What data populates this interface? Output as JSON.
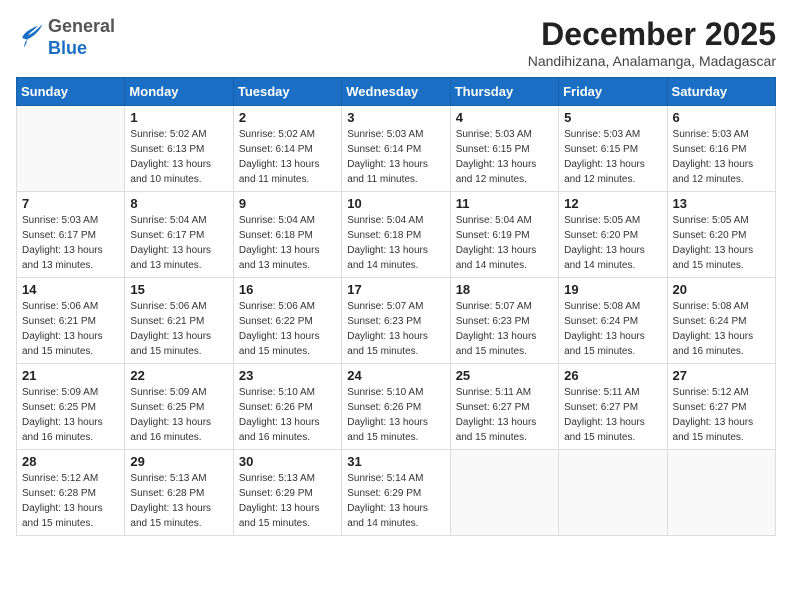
{
  "logo": {
    "general": "General",
    "blue": "Blue"
  },
  "title": "December 2025",
  "location": "Nandihizana, Analamanga, Madagascar",
  "days_of_week": [
    "Sunday",
    "Monday",
    "Tuesday",
    "Wednesday",
    "Thursday",
    "Friday",
    "Saturday"
  ],
  "weeks": [
    [
      {
        "day": "",
        "sunrise": "",
        "sunset": "",
        "daylight": ""
      },
      {
        "day": "1",
        "sunrise": "Sunrise: 5:02 AM",
        "sunset": "Sunset: 6:13 PM",
        "daylight": "Daylight: 13 hours and 10 minutes."
      },
      {
        "day": "2",
        "sunrise": "Sunrise: 5:02 AM",
        "sunset": "Sunset: 6:14 PM",
        "daylight": "Daylight: 13 hours and 11 minutes."
      },
      {
        "day": "3",
        "sunrise": "Sunrise: 5:03 AM",
        "sunset": "Sunset: 6:14 PM",
        "daylight": "Daylight: 13 hours and 11 minutes."
      },
      {
        "day": "4",
        "sunrise": "Sunrise: 5:03 AM",
        "sunset": "Sunset: 6:15 PM",
        "daylight": "Daylight: 13 hours and 12 minutes."
      },
      {
        "day": "5",
        "sunrise": "Sunrise: 5:03 AM",
        "sunset": "Sunset: 6:15 PM",
        "daylight": "Daylight: 13 hours and 12 minutes."
      },
      {
        "day": "6",
        "sunrise": "Sunrise: 5:03 AM",
        "sunset": "Sunset: 6:16 PM",
        "daylight": "Daylight: 13 hours and 12 minutes."
      }
    ],
    [
      {
        "day": "7",
        "sunrise": "Sunrise: 5:03 AM",
        "sunset": "Sunset: 6:17 PM",
        "daylight": "Daylight: 13 hours and 13 minutes."
      },
      {
        "day": "8",
        "sunrise": "Sunrise: 5:04 AM",
        "sunset": "Sunset: 6:17 PM",
        "daylight": "Daylight: 13 hours and 13 minutes."
      },
      {
        "day": "9",
        "sunrise": "Sunrise: 5:04 AM",
        "sunset": "Sunset: 6:18 PM",
        "daylight": "Daylight: 13 hours and 13 minutes."
      },
      {
        "day": "10",
        "sunrise": "Sunrise: 5:04 AM",
        "sunset": "Sunset: 6:18 PM",
        "daylight": "Daylight: 13 hours and 14 minutes."
      },
      {
        "day": "11",
        "sunrise": "Sunrise: 5:04 AM",
        "sunset": "Sunset: 6:19 PM",
        "daylight": "Daylight: 13 hours and 14 minutes."
      },
      {
        "day": "12",
        "sunrise": "Sunrise: 5:05 AM",
        "sunset": "Sunset: 6:20 PM",
        "daylight": "Daylight: 13 hours and 14 minutes."
      },
      {
        "day": "13",
        "sunrise": "Sunrise: 5:05 AM",
        "sunset": "Sunset: 6:20 PM",
        "daylight": "Daylight: 13 hours and 15 minutes."
      }
    ],
    [
      {
        "day": "14",
        "sunrise": "Sunrise: 5:06 AM",
        "sunset": "Sunset: 6:21 PM",
        "daylight": "Daylight: 13 hours and 15 minutes."
      },
      {
        "day": "15",
        "sunrise": "Sunrise: 5:06 AM",
        "sunset": "Sunset: 6:21 PM",
        "daylight": "Daylight: 13 hours and 15 minutes."
      },
      {
        "day": "16",
        "sunrise": "Sunrise: 5:06 AM",
        "sunset": "Sunset: 6:22 PM",
        "daylight": "Daylight: 13 hours and 15 minutes."
      },
      {
        "day": "17",
        "sunrise": "Sunrise: 5:07 AM",
        "sunset": "Sunset: 6:23 PM",
        "daylight": "Daylight: 13 hours and 15 minutes."
      },
      {
        "day": "18",
        "sunrise": "Sunrise: 5:07 AM",
        "sunset": "Sunset: 6:23 PM",
        "daylight": "Daylight: 13 hours and 15 minutes."
      },
      {
        "day": "19",
        "sunrise": "Sunrise: 5:08 AM",
        "sunset": "Sunset: 6:24 PM",
        "daylight": "Daylight: 13 hours and 15 minutes."
      },
      {
        "day": "20",
        "sunrise": "Sunrise: 5:08 AM",
        "sunset": "Sunset: 6:24 PM",
        "daylight": "Daylight: 13 hours and 16 minutes."
      }
    ],
    [
      {
        "day": "21",
        "sunrise": "Sunrise: 5:09 AM",
        "sunset": "Sunset: 6:25 PM",
        "daylight": "Daylight: 13 hours and 16 minutes."
      },
      {
        "day": "22",
        "sunrise": "Sunrise: 5:09 AM",
        "sunset": "Sunset: 6:25 PM",
        "daylight": "Daylight: 13 hours and 16 minutes."
      },
      {
        "day": "23",
        "sunrise": "Sunrise: 5:10 AM",
        "sunset": "Sunset: 6:26 PM",
        "daylight": "Daylight: 13 hours and 16 minutes."
      },
      {
        "day": "24",
        "sunrise": "Sunrise: 5:10 AM",
        "sunset": "Sunset: 6:26 PM",
        "daylight": "Daylight: 13 hours and 15 minutes."
      },
      {
        "day": "25",
        "sunrise": "Sunrise: 5:11 AM",
        "sunset": "Sunset: 6:27 PM",
        "daylight": "Daylight: 13 hours and 15 minutes."
      },
      {
        "day": "26",
        "sunrise": "Sunrise: 5:11 AM",
        "sunset": "Sunset: 6:27 PM",
        "daylight": "Daylight: 13 hours and 15 minutes."
      },
      {
        "day": "27",
        "sunrise": "Sunrise: 5:12 AM",
        "sunset": "Sunset: 6:27 PM",
        "daylight": "Daylight: 13 hours and 15 minutes."
      }
    ],
    [
      {
        "day": "28",
        "sunrise": "Sunrise: 5:12 AM",
        "sunset": "Sunset: 6:28 PM",
        "daylight": "Daylight: 13 hours and 15 minutes."
      },
      {
        "day": "29",
        "sunrise": "Sunrise: 5:13 AM",
        "sunset": "Sunset: 6:28 PM",
        "daylight": "Daylight: 13 hours and 15 minutes."
      },
      {
        "day": "30",
        "sunrise": "Sunrise: 5:13 AM",
        "sunset": "Sunset: 6:29 PM",
        "daylight": "Daylight: 13 hours and 15 minutes."
      },
      {
        "day": "31",
        "sunrise": "Sunrise: 5:14 AM",
        "sunset": "Sunset: 6:29 PM",
        "daylight": "Daylight: 13 hours and 14 minutes."
      },
      {
        "day": "",
        "sunrise": "",
        "sunset": "",
        "daylight": ""
      },
      {
        "day": "",
        "sunrise": "",
        "sunset": "",
        "daylight": ""
      },
      {
        "day": "",
        "sunrise": "",
        "sunset": "",
        "daylight": ""
      }
    ]
  ]
}
